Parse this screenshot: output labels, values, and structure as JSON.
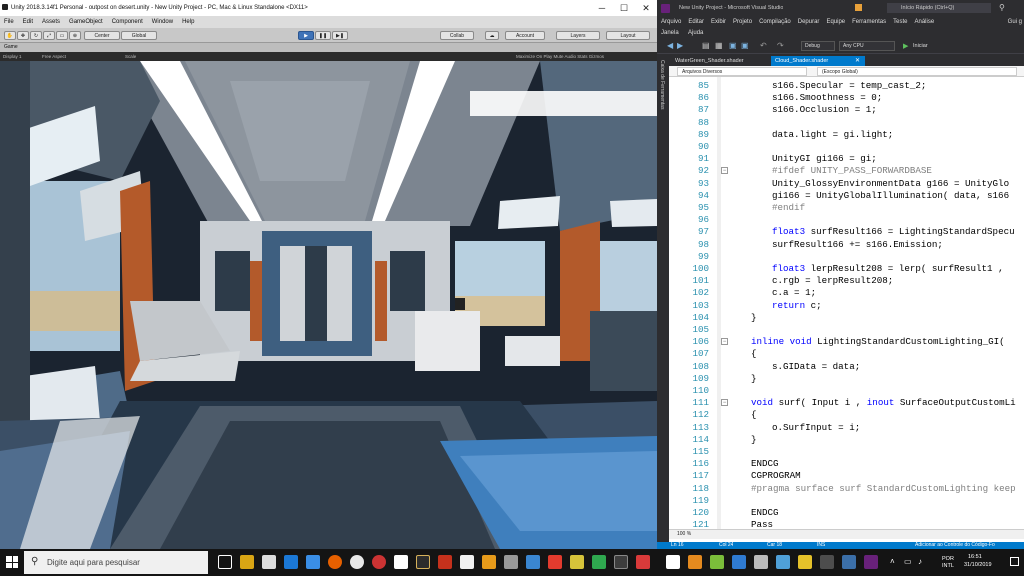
{
  "unity": {
    "title": "Unity 2018.3.14f1 Personal - outpost on desert.unity - New Unity Project - PC, Mac & Linux Standalone <DX11>",
    "menu": [
      "File",
      "Edit",
      "Assets",
      "GameObject",
      "Component",
      "Window",
      "Help"
    ],
    "toolbar": {
      "center": "Center",
      "global": "Global",
      "collab": "Collab",
      "account": "Account",
      "layers": "Layers",
      "layout": "Layout"
    },
    "game_tab": "Game",
    "game_bar": {
      "display": "Display 1",
      "aspect": "Free Aspect",
      "scale": "Scale",
      "options": "Maximize On Play   Mute Audio   Stats   Gizmos"
    }
  },
  "vs": {
    "title": "New Unity Project - Microsoft Visual Studio",
    "quick_launch": "Início Rápido (Ctrl+Q)",
    "menu1": [
      "Arquivo",
      "Editar",
      "Exibir",
      "Projeto",
      "Compilação",
      "Depurar",
      "Equipe",
      "Ferramentas",
      "Teste",
      "Análise"
    ],
    "guest": "Gui g",
    "menu2": [
      "Janela",
      "Ajuda"
    ],
    "debug_config": "Debug",
    "platform": "Any CPU",
    "start": "Iniciar",
    "side_tab": "Caixa de Ferramentas",
    "tabs": [
      "WaterGreen_Shader.shader",
      "Cloud_Shader.shader"
    ],
    "nav_left": "Arquivos Diversos",
    "nav_right": "(Escopo Global)",
    "zoom": "100 %",
    "status": {
      "line": "Ln 16",
      "col": "Col 24",
      "char": "Car 18",
      "ins": "INS",
      "source_control": "Adicionar ao Controle do Código-Fo"
    },
    "code_lines": [
      {
        "n": "85",
        "t": "s166.Specular = temp_cast_2;"
      },
      {
        "n": "86",
        "t": "s166.Smoothness = 0;"
      },
      {
        "n": "87",
        "t": "s166.Occlusion = 1;"
      },
      {
        "n": "88",
        "t": ""
      },
      {
        "n": "89",
        "t": "data.light = gi.light;"
      },
      {
        "n": "90",
        "t": ""
      },
      {
        "n": "91",
        "t": "UnityGI gi166 = gi;"
      },
      {
        "n": "92",
        "t": "#ifdef UNITY_PASS_FORWARDBASE"
      },
      {
        "n": "93",
        "t": "Unity_GlossyEnvironmentData g166 = UnityGlo"
      },
      {
        "n": "94",
        "t": "gi166 = UnityGlobalIllumination( data, s166"
      },
      {
        "n": "95",
        "t": "#endif"
      },
      {
        "n": "96",
        "t": ""
      },
      {
        "n": "97",
        "t": "float3 surfResult166 = LightingStandardSpecu"
      },
      {
        "n": "98",
        "t": "surfResult166 += s166.Emission;"
      },
      {
        "n": "99",
        "t": ""
      },
      {
        "n": "100",
        "t": "float3 lerpResult208 = lerp( surfResult1 ,"
      },
      {
        "n": "101",
        "t": "c.rgb = lerpResult208;"
      },
      {
        "n": "102",
        "t": "c.a = 1;"
      },
      {
        "n": "103",
        "t": "return c;"
      },
      {
        "n": "104",
        "t": "}"
      },
      {
        "n": "105",
        "t": ""
      },
      {
        "n": "106",
        "t": "inline void LightingStandardCustomLighting_GI("
      },
      {
        "n": "107",
        "t": "{"
      },
      {
        "n": "108",
        "t": "s.GIData = data;"
      },
      {
        "n": "109",
        "t": "}"
      },
      {
        "n": "110",
        "t": ""
      },
      {
        "n": "111",
        "t": "void surf( Input i , inout SurfaceOutputCustomLi"
      },
      {
        "n": "112",
        "t": "{"
      },
      {
        "n": "113",
        "t": "o.SurfInput = i;"
      },
      {
        "n": "114",
        "t": "}"
      },
      {
        "n": "115",
        "t": ""
      },
      {
        "n": "116",
        "t": "ENDCG"
      },
      {
        "n": "117",
        "t": "CGPROGRAM"
      },
      {
        "n": "118",
        "t": "#pragma surface surf StandardCustomLighting keep"
      },
      {
        "n": "119",
        "t": ""
      },
      {
        "n": "120",
        "t": "ENDCG"
      },
      {
        "n": "121",
        "t": "Pass"
      }
    ]
  },
  "taskbar": {
    "search_placeholder": "Digite aqui para pesquisar",
    "lang1": "POR",
    "lang2": "INTL",
    "time": "16:51",
    "date": "31/10/2019"
  },
  "colors": {
    "vs_blue": "#007acc",
    "vs_dark": "#2d2d30",
    "unity_play": "#3f73b8"
  }
}
